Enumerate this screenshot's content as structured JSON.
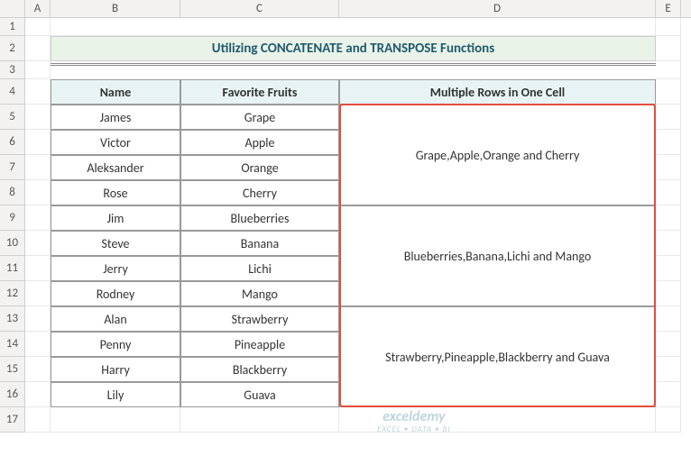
{
  "columns": [
    "A",
    "B",
    "C",
    "D",
    "E"
  ],
  "rows_visible": 17,
  "title": "Utilizing CONCATENATE and TRANSPOSE Functions",
  "headers": {
    "name": "Name",
    "fruits": "Favorite Fruits",
    "multi": "Multiple Rows in One Cell"
  },
  "data": [
    {
      "name": "James",
      "fruit": "Grape"
    },
    {
      "name": "Victor",
      "fruit": "Apple"
    },
    {
      "name": "Aleksander",
      "fruit": "Orange"
    },
    {
      "name": "Rose",
      "fruit": "Cherry"
    },
    {
      "name": "Jim",
      "fruit": "Blueberries"
    },
    {
      "name": "Steve",
      "fruit": "Banana"
    },
    {
      "name": "Jerry",
      "fruit": "Lichi"
    },
    {
      "name": "Rodney",
      "fruit": "Mango"
    },
    {
      "name": "Alan",
      "fruit": "Strawberry"
    },
    {
      "name": "Penny",
      "fruit": "Pineapple"
    },
    {
      "name": "Harry",
      "fruit": "Blackberry"
    },
    {
      "name": "Lily",
      "fruit": "Guava"
    }
  ],
  "merged_results": [
    "Grape,Apple,Orange and Cherry",
    "Blueberries,Banana,Lichi and Mango",
    "Strawberry,Pineapple,Blackberry and Guava"
  ],
  "watermark": {
    "line1": "exceldemy",
    "line2": "EXCEL • DATA • BI"
  }
}
